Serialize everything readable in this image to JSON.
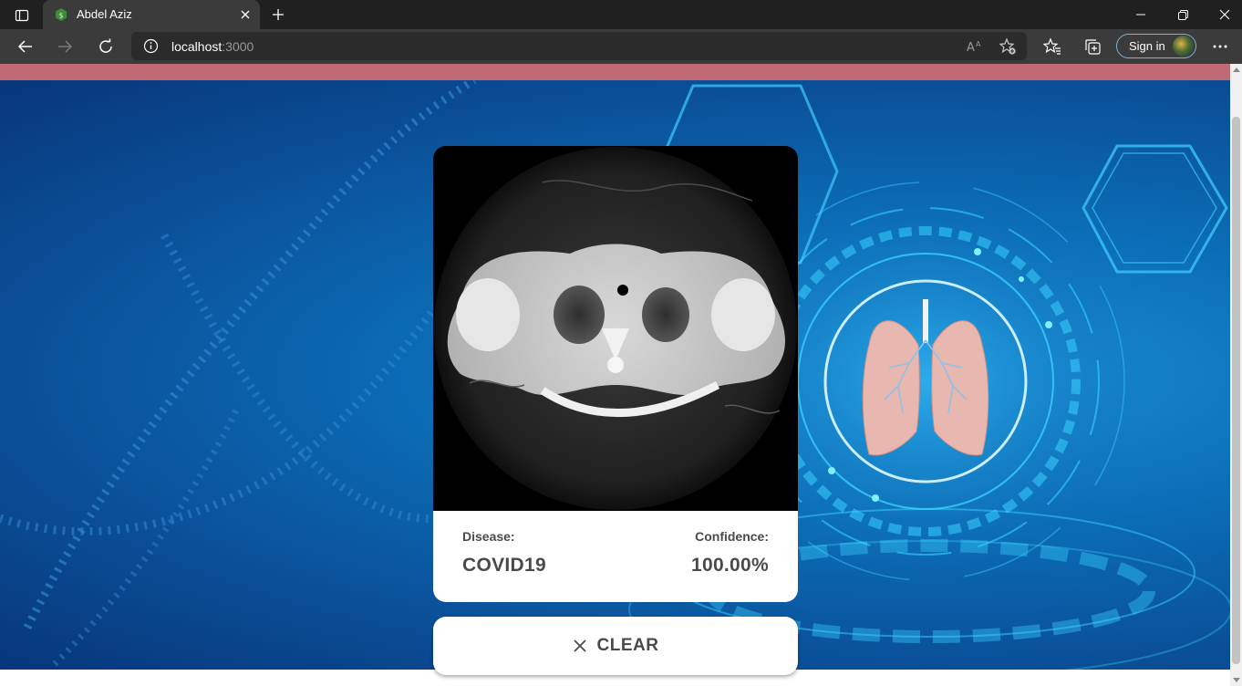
{
  "browser": {
    "tab": {
      "title": "Abdel Aziz",
      "favicon": "node-favicon-icon"
    },
    "address": {
      "host": "localhost",
      "port": ":3000"
    },
    "signin_label": "Sign in",
    "icons": {
      "back": "back-arrow-icon",
      "forward": "forward-arrow-icon",
      "reload": "reload-icon",
      "read_aloud": "read-aloud-icon",
      "add_favorite": "add-favorite-icon",
      "favorites": "favorites-icon",
      "collections": "collections-icon",
      "more": "more-icon"
    }
  },
  "page": {
    "banner_color": "#c06a75",
    "result": {
      "disease_label": "Disease:",
      "disease_value": "COVID19",
      "confidence_label": "Confidence:",
      "confidence_value": "100.00%"
    },
    "clear_label": "CLEAR"
  }
}
